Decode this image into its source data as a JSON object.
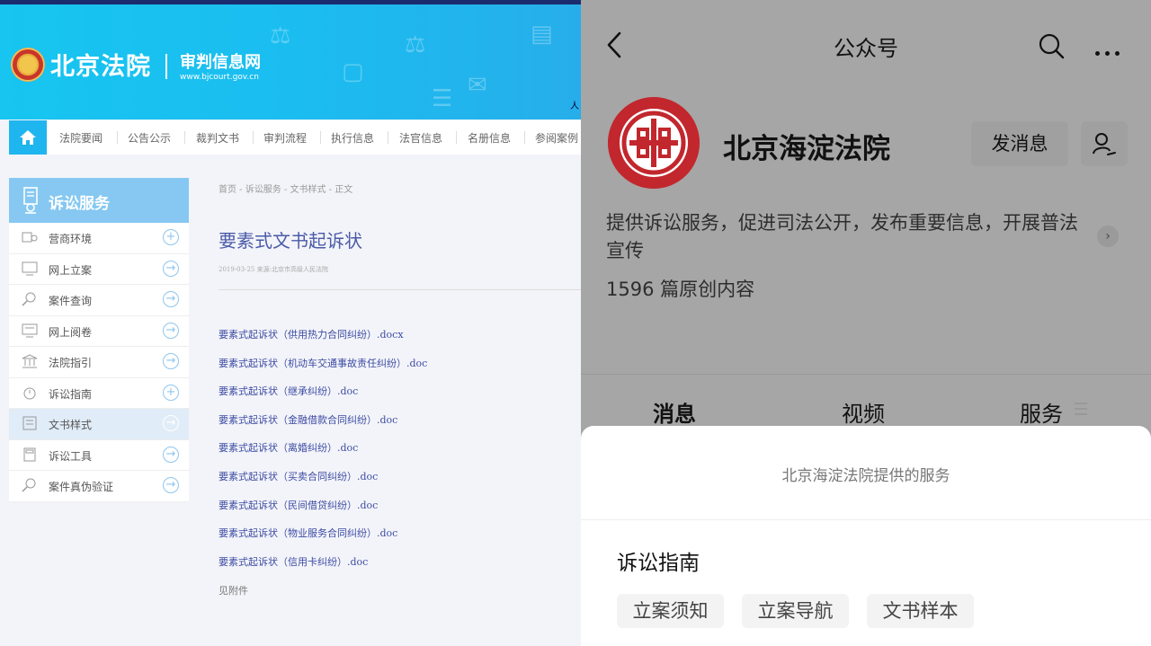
{
  "left_site": {
    "logo_title": "北京法院",
    "logo_subtitle": "审判信息网",
    "logo_url": "www.bjcourt.gov.cn",
    "banner_edge_text": "人",
    "nav": [
      "法院要闻",
      "公告公示",
      "裁判文书",
      "审判流程",
      "执行信息",
      "法官信息",
      "名册信息",
      "参阅案例"
    ],
    "sidebar": {
      "header": "诉讼服务",
      "items": [
        {
          "label": "营商环境",
          "btn": "+"
        },
        {
          "label": "网上立案",
          "btn": "→"
        },
        {
          "label": "案件查询",
          "btn": "→"
        },
        {
          "label": "网上阅卷",
          "btn": "→"
        },
        {
          "label": "法院指引",
          "btn": "→"
        },
        {
          "label": "诉讼指南",
          "btn": "+"
        },
        {
          "label": "文书样式",
          "btn": "→",
          "active": true
        },
        {
          "label": "诉讼工具",
          "btn": "→"
        },
        {
          "label": "案件真伪验证",
          "btn": "→"
        }
      ]
    },
    "breadcrumb": "首页 - 诉讼服务 - 文书样式 - 正文",
    "article": {
      "title": "要素式文书起诉状",
      "meta": "2019-03-25   来源:北京市高级人民法院",
      "files": [
        "要素式起诉状（供用热力合同纠纷）.docx",
        "要素式起诉状（机动车交通事故责任纠纷）.doc",
        "要素式起诉状（继承纠纷）.doc",
        "要素式起诉状（金融借款合同纠纷）.doc",
        "要素式起诉状（离婚纠纷）.doc",
        "要素式起诉状（买卖合同纠纷）.doc",
        "要素式起诉状（民间借贷纠纷）.doc",
        "要素式起诉状（物业服务合同纠纷）.doc",
        "要素式起诉状（信用卡纠纷）.doc"
      ],
      "attachment": "见附件"
    }
  },
  "right_app": {
    "header_title": "公众号",
    "account_name": "北京海淀法院",
    "message_button": "发消息",
    "description": "提供诉讼服务，促进司法公开，发布重要信息，开展普法宣传",
    "article_count": "1596 篇原创内容",
    "tabs": [
      "消息",
      "视频",
      "服务"
    ],
    "sheet": {
      "title": "北京海淀法院提供的服务",
      "section": "诉讼指南",
      "chips": [
        "立案须知",
        "立案导航",
        "文书样本"
      ]
    }
  }
}
